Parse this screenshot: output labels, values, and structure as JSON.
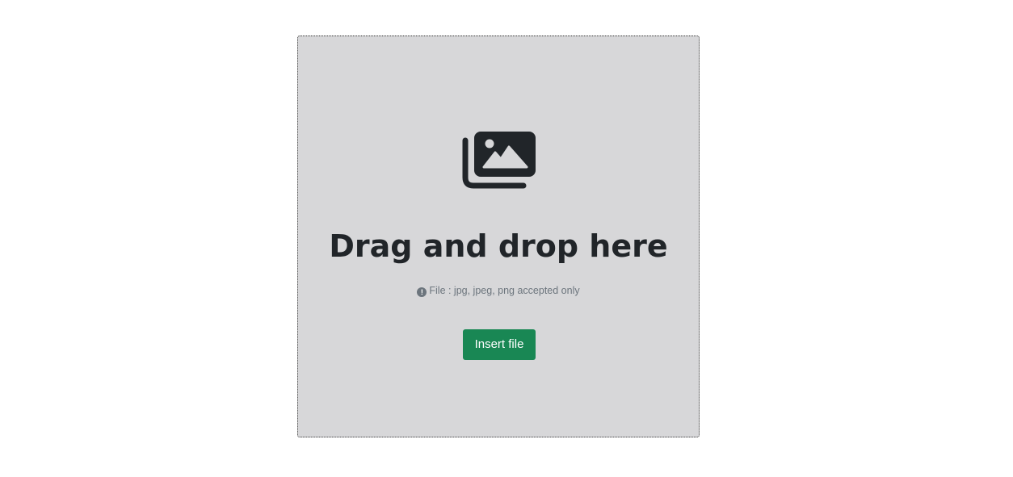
{
  "dropzone": {
    "icon": "images-icon",
    "title": "Drag and drop here",
    "hint_icon": "info-circle-icon",
    "hint_text": "File : jpg, jpeg, png accepted only",
    "button_label": "Insert file",
    "colors": {
      "background": "#d7d7d9",
      "button": "#198754",
      "title": "#212529",
      "hint": "#6c757d"
    }
  }
}
